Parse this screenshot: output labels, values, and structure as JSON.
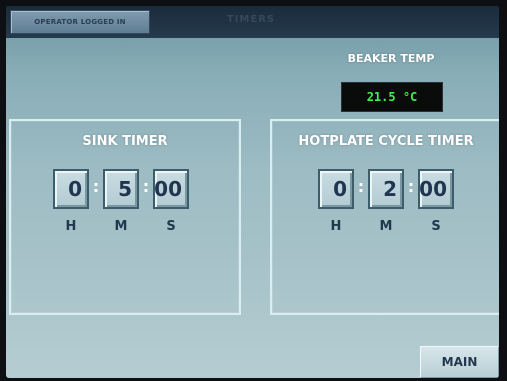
{
  "header": {
    "operator_label": "OPERATOR LOGGED IN",
    "title": "TIMERS"
  },
  "beaker": {
    "label": "BEAKER TEMP",
    "value": "21.5 °C"
  },
  "sink_timer": {
    "title": "SINK TIMER",
    "hours": "0",
    "minutes": "5",
    "seconds": "00",
    "unit_h": "H",
    "unit_m": "M",
    "unit_s": "S"
  },
  "hotplate_timer": {
    "title": "HOTPLATE CYCLE TIMER",
    "hours": "0",
    "minutes": "2",
    "seconds": "00",
    "unit_h": "H",
    "unit_m": "M",
    "unit_s": "S"
  },
  "footer": {
    "main_label": "MAIN"
  },
  "colors": {
    "panel_top": "#6b94a0",
    "panel_bottom": "#b5cdd2",
    "header": "#1a2b3b",
    "temp_text": "#43f04d",
    "digit_text": "#1f3550"
  }
}
